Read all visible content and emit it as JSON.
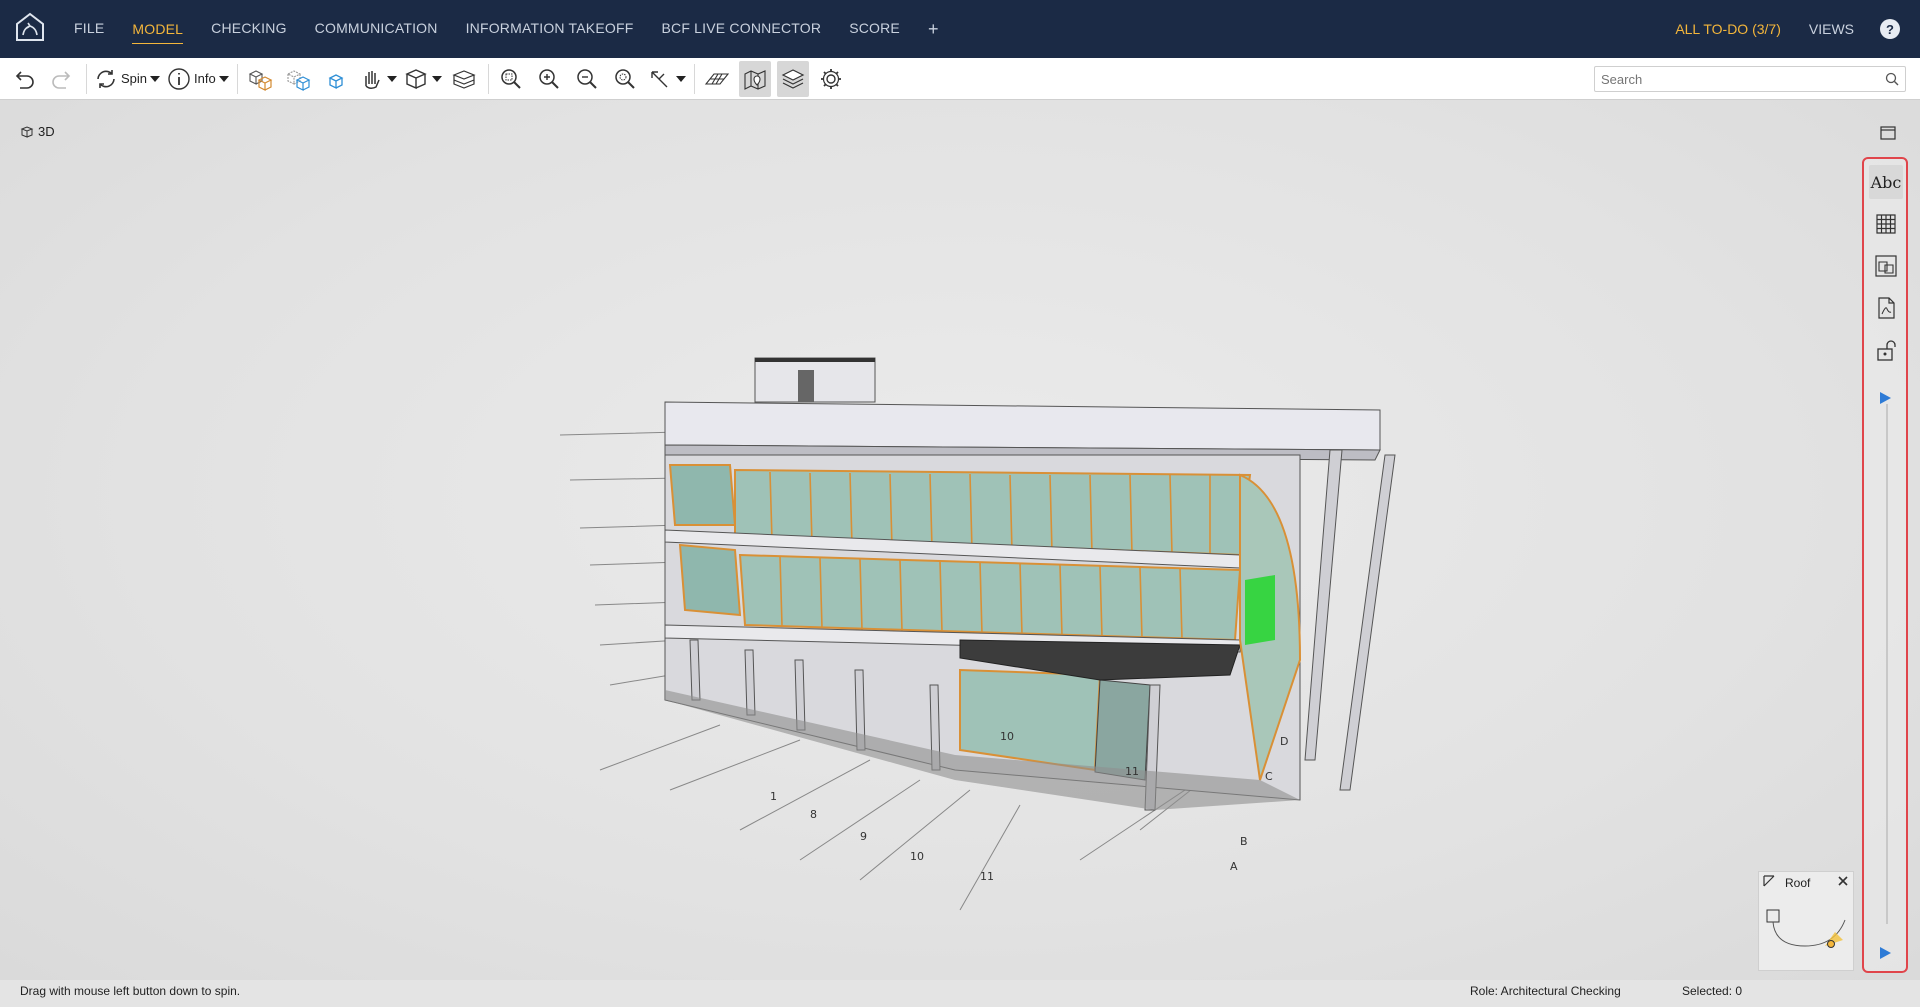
{
  "nav": {
    "items": [
      "FILE",
      "MODEL",
      "CHECKING",
      "COMMUNICATION",
      "INFORMATION TAKEOFF",
      "BCF LIVE CONNECTOR",
      "SCORE"
    ],
    "active": "MODEL",
    "add": "+",
    "todo": "ALL TO-DO (3/7)",
    "views": "VIEWS",
    "help": "?"
  },
  "toolbar": {
    "spin_label": "Spin",
    "info_label": "Info",
    "search_placeholder": "Search"
  },
  "view": {
    "label": "3D"
  },
  "right_panel": {
    "text_tool": "Abc"
  },
  "navigator": {
    "title": "Roof"
  },
  "status": {
    "hint": "Drag with mouse left button down to spin.",
    "role": "Role: Architectural Checking",
    "selected": "Selected: 0"
  },
  "colors": {
    "nav_bg": "#1b2a45",
    "accent": "#f4b63b",
    "highlight_border": "#e0454b",
    "slider": "#2e7bd6"
  },
  "model_labels": [
    "1",
    "8",
    "9",
    "10",
    "11",
    "A",
    "B",
    "C",
    "D",
    "10",
    "11"
  ]
}
